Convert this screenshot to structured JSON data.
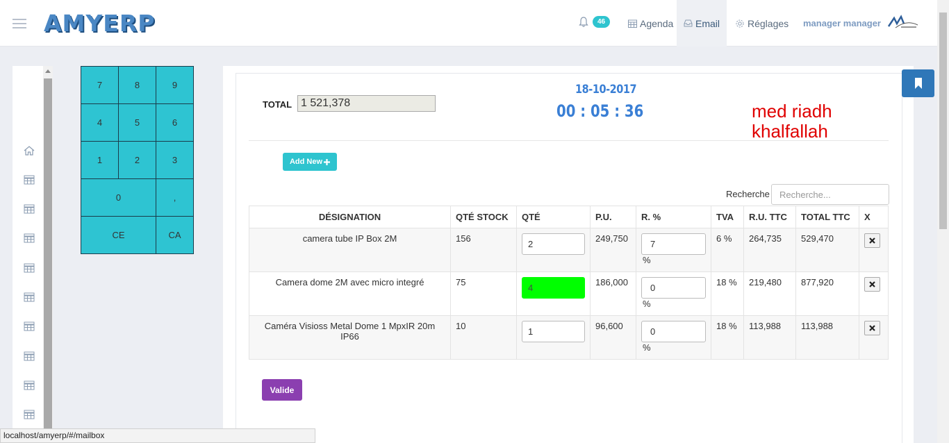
{
  "app": {
    "logo": "AMYERP"
  },
  "navbar": {
    "notification_count": "46",
    "agenda": "Agenda",
    "email": "Email",
    "settings": "Réglages",
    "user": "manager manager"
  },
  "keypad": {
    "keys": [
      "7",
      "8",
      "9",
      "4",
      "5",
      "6",
      "1",
      "2",
      "3",
      "0",
      ",",
      "CE",
      "CA"
    ]
  },
  "pos": {
    "total_label": "TOTAL",
    "total_value": "1 521,378",
    "date": "18-10-2017",
    "clock": "00 : 05 : 36",
    "cashier": "med riadh khalfallah",
    "add_new": "Add New",
    "search_label": "Recherche",
    "search_placeholder": "Recherche...",
    "validate": "Valide"
  },
  "table": {
    "headers": [
      "DÉSIGNATION",
      "QTÉ STOCK",
      "QTÉ",
      "P.U.",
      "R. %",
      "TVA",
      "R.U. TTC",
      "TOTAL TTC",
      "X"
    ],
    "rows": [
      {
        "designation": "camera tube IP Box 2M",
        "stock": "156",
        "qty": "2",
        "pu": "249,750",
        "remise": "7",
        "pct": "%",
        "tva": "6 %",
        "ru_ttc": "264,735",
        "total_ttc": "529,470"
      },
      {
        "designation": "Camera dome 2M avec micro integré",
        "stock": "75",
        "qty": "4",
        "pu": "186,000",
        "remise": "0",
        "pct": "%",
        "tva": "18 %",
        "ru_ttc": "219,480",
        "total_ttc": "877,920"
      },
      {
        "designation": "Caméra Visioss Metal Dome 1 MpxIR 20m IP66",
        "stock": "10",
        "qty": "1",
        "pu": "96,600",
        "remise": "0",
        "pct": "%",
        "tva": "18 %",
        "ru_ttc": "113,988",
        "total_ttc": "113,988"
      }
    ]
  },
  "statusbar": {
    "url": "localhost/amyerp/#/mailbox"
  },
  "colors": {
    "accent": "#2ec4cf",
    "keypad": "#2ec4d2",
    "validate": "#8b3fb0",
    "highlight_qty": "#00ff00",
    "clock": "#3a7fd5",
    "cashier": "#e00000"
  }
}
